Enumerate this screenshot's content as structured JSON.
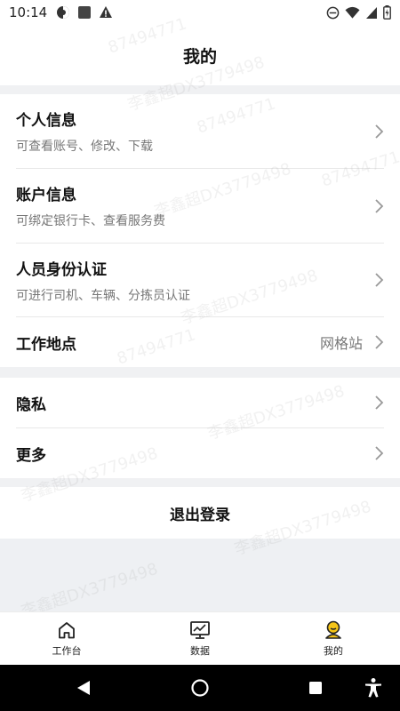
{
  "status": {
    "time": "10:14"
  },
  "header": {
    "title": "我的"
  },
  "menu": {
    "personal": {
      "title": "个人信息",
      "sub": "可查看账号、修改、下载"
    },
    "account": {
      "title": "账户信息",
      "sub": "可绑定银行卡、查看服务费"
    },
    "identity": {
      "title": "人员身份认证",
      "sub": "可进行司机、车辆、分拣员认证"
    },
    "workplace": {
      "title": "工作地点",
      "value": "网格站"
    },
    "privacy": {
      "title": "隐私"
    },
    "more": {
      "title": "更多"
    }
  },
  "logout": {
    "label": "退出登录"
  },
  "tabs": [
    {
      "label": "工作台",
      "icon": "home-icon"
    },
    {
      "label": "数据",
      "icon": "monitor-chart-icon"
    },
    {
      "label": "我的",
      "icon": "user-avatar-icon"
    }
  ],
  "watermark": {
    "a": "87494771",
    "b": "李鑫超DX3779498"
  },
  "colors": {
    "accent": "#f5c518",
    "background": "#f0f1f3"
  }
}
